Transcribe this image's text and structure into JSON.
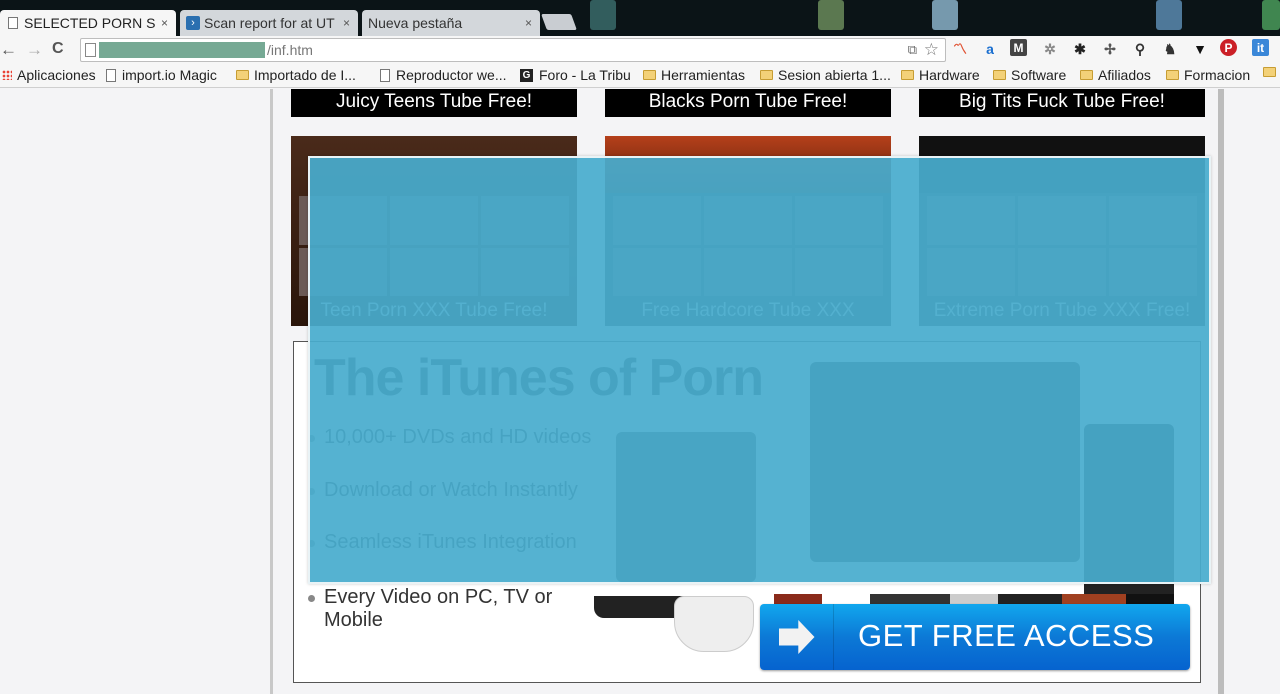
{
  "browser": {
    "tabs": [
      {
        "title": "SELECTED PORN SITE",
        "favicon": "page-icon",
        "active": true
      },
      {
        "title": "Scan report for at UT",
        "favicon": "scan-report-icon",
        "active": false
      },
      {
        "title": "Nueva pestaña",
        "favicon": "",
        "active": false
      }
    ],
    "close_glyph": "×",
    "nav": {
      "back": "←",
      "forward": "→",
      "reload": "C"
    },
    "address": {
      "redacted": true,
      "url_suffix": "/inf.htm"
    },
    "address_icons": {
      "translate": "translate-icon",
      "star": "☆"
    },
    "extensions": [
      {
        "name": "chart-extension-icon",
        "glyph": "〽",
        "color": "#e05030"
      },
      {
        "name": "amazon-assistant-icon",
        "glyph": "a",
        "color": "#1a6fd0"
      },
      {
        "name": "m-extension-icon",
        "glyph": "M",
        "color": "#ffffff",
        "bg": "#444444"
      },
      {
        "name": "gear-extension-icon",
        "glyph": "✲",
        "color": "#888888"
      },
      {
        "name": "settings-icon",
        "glyph": "✱",
        "color": "#222222"
      },
      {
        "name": "bug-icon",
        "glyph": "✢",
        "color": "#555555"
      },
      {
        "name": "lamp-icon",
        "glyph": "⚲",
        "color": "#333333"
      },
      {
        "name": "evernote-icon",
        "glyph": "♞",
        "color": "#333333"
      },
      {
        "name": "owl-icon",
        "glyph": "▼",
        "color": "#111111"
      },
      {
        "name": "pinterest-icon",
        "glyph": "P",
        "color": "#ffffff",
        "bg": "#cb2027"
      },
      {
        "name": "it-extension-icon",
        "glyph": "it",
        "color": "#ffffff",
        "bg": "#3a87d8"
      }
    ],
    "bookmarks": [
      {
        "label": "Aplicaciones",
        "icon": "apps-icon"
      },
      {
        "label": "import.io Magic",
        "icon": "page-icon"
      },
      {
        "label": "Importado de I...",
        "icon": "folder-icon"
      },
      {
        "label": "Reproductor we...",
        "icon": "page-icon"
      },
      {
        "label": "Foro - La Tribu",
        "icon": "g-icon"
      },
      {
        "label": "Herramientas",
        "icon": "folder-icon"
      },
      {
        "label": "Sesion abierta 1...",
        "icon": "folder-icon"
      },
      {
        "label": "Hardware",
        "icon": "folder-icon"
      },
      {
        "label": "Software",
        "icon": "folder-icon"
      },
      {
        "label": "Afiliados",
        "icon": "folder-icon"
      },
      {
        "label": "Formacion",
        "icon": "folder-icon"
      },
      {
        "label": "",
        "icon": "folder-icon"
      }
    ]
  },
  "page": {
    "captions": [
      "Juicy Teens Tube Free!",
      "Blacks Porn Tube Free!",
      "Big Tits Fuck Tube Free!"
    ],
    "thumbnails": [
      {
        "label": "Teen Porn XXX Tube Free!"
      },
      {
        "label": "Free Hardcore Tube XXX"
      },
      {
        "label": "Extreme Porn Tube XXX Free!"
      }
    ],
    "promo": {
      "title": "The iTunes of Porn",
      "bullets": [
        "10,000+ DVDs and HD videos",
        "Download or Watch Instantly",
        "Seamless iTunes Integration",
        "Every Video on PC, TV or Mobile"
      ],
      "cta_label": "GET FREE ACCESS"
    },
    "overlay_color": "#48accd"
  }
}
